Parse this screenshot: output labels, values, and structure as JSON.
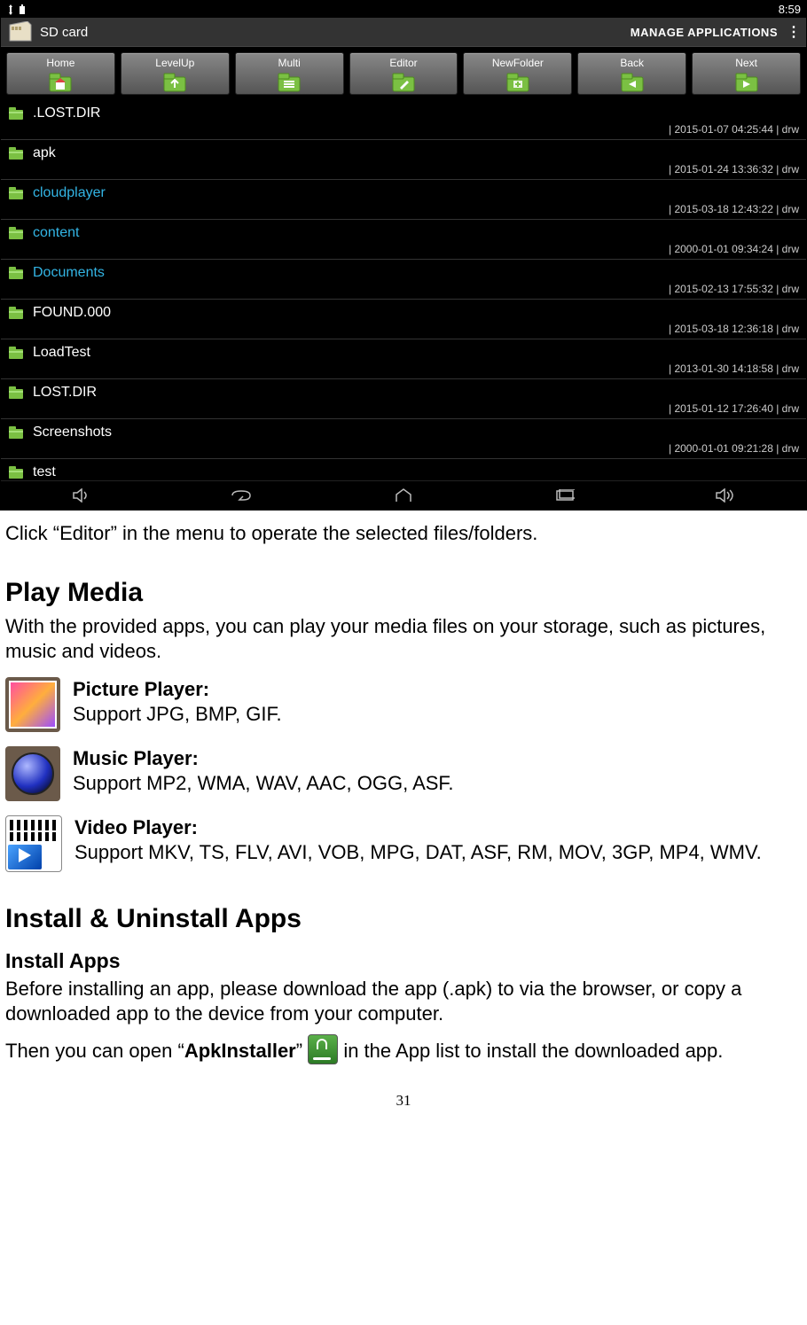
{
  "status_bar": {
    "usb_icon": "usb-icon",
    "batt_icon": "battery-icon",
    "time": "8:59"
  },
  "title_bar": {
    "label": "SD card",
    "action": "MANAGE APPLICATIONS"
  },
  "toolbar": [
    {
      "label": "Home",
      "icon": "home"
    },
    {
      "label": "LevelUp",
      "icon": "levelup"
    },
    {
      "label": "Multi",
      "icon": "multi"
    },
    {
      "label": "Editor",
      "icon": "editor"
    },
    {
      "label": "NewFolder",
      "icon": "newfolder"
    },
    {
      "label": "Back",
      "icon": "back"
    },
    {
      "label": "Next",
      "icon": "next"
    }
  ],
  "files": [
    {
      "name": ".LOST.DIR",
      "meta": "| 2015-01-07 04:25:44 | drw",
      "link": false
    },
    {
      "name": "apk",
      "meta": "| 2015-01-24 13:36:32 | drw",
      "link": false
    },
    {
      "name": "cloudplayer",
      "meta": "| 2015-03-18 12:43:22 | drw",
      "link": true
    },
    {
      "name": "content",
      "meta": "| 2000-01-01 09:34:24 | drw",
      "link": true
    },
    {
      "name": "Documents",
      "meta": "| 2015-02-13 17:55:32 | drw",
      "link": true
    },
    {
      "name": "FOUND.000",
      "meta": "| 2015-03-18 12:36:18 | drw",
      "link": false
    },
    {
      "name": "LoadTest",
      "meta": "| 2013-01-30 14:18:58 | drw",
      "link": false
    },
    {
      "name": "LOST.DIR",
      "meta": "| 2015-01-12 17:26:40 | drw",
      "link": false
    },
    {
      "name": "Screenshots",
      "meta": "| 2000-01-01 09:21:28 | drw",
      "link": false
    },
    {
      "name": "test",
      "meta": "",
      "link": false
    }
  ],
  "doc": {
    "p1": "Click “Editor” in the menu to operate the selected files/folders.",
    "h_play": "Play Media",
    "p2": "With the provided apps, you can play your media files on your storage, such as pictures, music and videos.",
    "pic_t": "Picture Player:",
    "pic_d": "Support JPG, BMP, GIF.",
    "mus_t": "Music Player:",
    "mus_d": "Support MP2, WMA, WAV, AAC, OGG, ASF.",
    "vid_t": "Video Player:",
    "vid_d": "Support MKV, TS, FLV, AVI, VOB, MPG, DAT, ASF, RM, MOV, 3GP, MP4, WMV.",
    "h_inst": "Install & Uninstall Apps",
    "h_inst_sub": "Install Apps",
    "p3": "Before installing an app, please download the app (.apk) to via the browser, or copy a downloaded app to the device from your computer.",
    "p4a": "Then you can open “",
    "p4b": "ApkInstaller",
    "p4c": "” ",
    "p4d": " in the App list to install the downloaded app.",
    "page_num": "31"
  }
}
